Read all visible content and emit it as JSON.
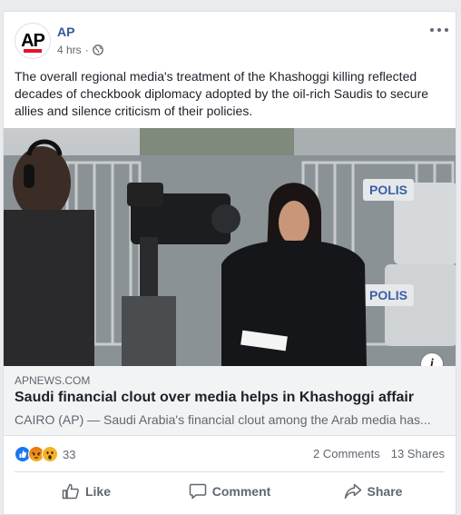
{
  "post": {
    "page_name": "AP",
    "timestamp": "4 hrs",
    "separator": "·",
    "privacy_icon": "globe-icon",
    "avatar_text": "AP",
    "text": "The overall regional media's treatment of the Khashoggi killing reflected decades of checkbook diplomacy adopted by the oil-rich Saudis to secure allies and silence criticism of their policies."
  },
  "media": {
    "police_sign_top": "POLIS",
    "police_sign_bottom": "POLIS"
  },
  "link_preview": {
    "domain": "APNEWS.COM",
    "title": "Saudi financial clout over media helps in Khashoggi affair",
    "description": "CAIRO (AP) — Saudi Arabia's financial clout among the Arab media has..."
  },
  "stats": {
    "reaction_icons": [
      "like-icon",
      "angry-icon",
      "wow-icon"
    ],
    "reaction_count": "33",
    "comments": "2 Comments",
    "shares": "13 Shares"
  },
  "actions": {
    "like": "Like",
    "comment": "Comment",
    "share": "Share"
  },
  "colors": {
    "brand_blue": "#365899",
    "like_blue": "#1877f2",
    "ap_red": "#e4142b",
    "reaction_yellow": "#f7b125"
  }
}
